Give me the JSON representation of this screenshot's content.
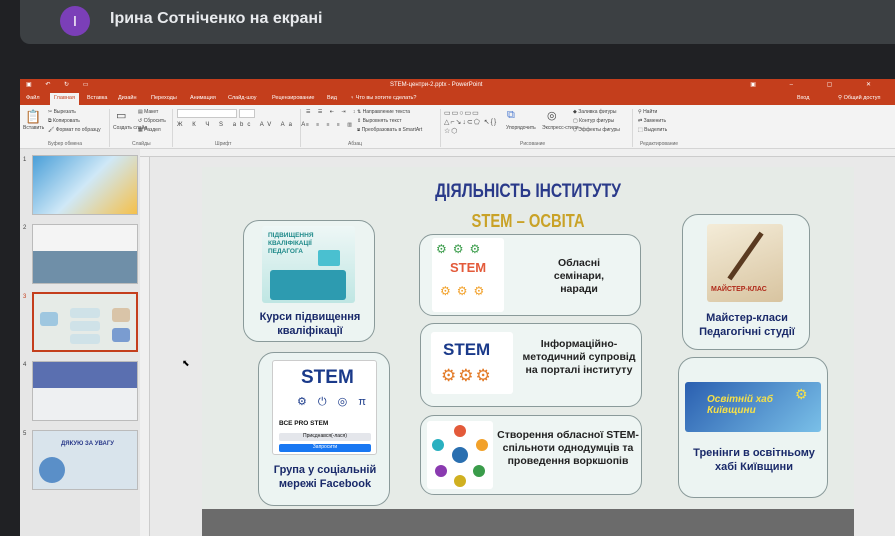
{
  "meet": {
    "avatar_letter": "I",
    "presenter_label": "Ірина Сотніченко на екрані"
  },
  "powerpoint": {
    "window_title": "STEM-центри-2.pptx - PowerPoint",
    "tabs": [
      "Файл",
      "Главная",
      "Вставка",
      "Дизайн",
      "Переходы",
      "Анимация",
      "Слайд-шоу",
      "Рецензирование",
      "Вид"
    ],
    "tell_me": "Что вы хотите сделать?",
    "signin": "Вход",
    "share": "Общий доступ",
    "ribbon": {
      "paste": "Вставить",
      "cut": "Вырезать",
      "copy": "Копировать",
      "format_painter": "Формат по образцу",
      "new_slide": "Создать слайд",
      "layout": "Макет",
      "reset": "Сбросить",
      "section": "Раздел",
      "text_direction": "Направление текста",
      "align_text": "Выровнять текст",
      "smartart": "Преобразовать в SmartArt",
      "arrange": "Упорядочить",
      "quick_styles": "Экспресс-стили",
      "shape_fill": "Заливка фигуры",
      "shape_outline": "Контур фигуры",
      "shape_effects": "Эффекты фигуры",
      "find": "Найти",
      "replace": "Заменить",
      "select": "Выделить",
      "groups": [
        "Буфер обмена",
        "Слайды",
        "Шрифт",
        "Абзац",
        "Рисование",
        "Редактирование"
      ]
    },
    "slide_numbers": [
      "1",
      "2",
      "3",
      "4",
      "5"
    ],
    "thumb5_text": "ДЯКУЮ ЗА УВАГУ"
  },
  "slide": {
    "title": "ДІЯЛЬНІСТЬ ІНСТИТУТУ",
    "subtitle": "STEM – ОСВІТА",
    "cards": {
      "courses": "Курси підвищення кваліфікації",
      "courses_img_text": "ПІДВИЩЕННЯ КВАЛІФІКАЦІЇ ПЕДАГОГА",
      "facebook": "Група у соціальній мережі Facebook",
      "fb_logo": "STEM",
      "fb_page": "ВСЕ PRO STEM",
      "fb_btn1": "Приєднався(-лася)",
      "fb_btn2": "Запросити",
      "seminars": "Обласні семінари, наради",
      "seminars_logo": "STEM",
      "info": "Інформаційно-методичний супровід на порталі інституту",
      "info_logo": "STEM",
      "community": "Створення обласної STEM-спільноти однодумців та проведення воркшопів",
      "master": "Майстер-класи Педагогічні студії",
      "master_img_text": "МАЙСТЕР-КЛАС",
      "trainings": "Тренінги в освітньому хабі Київщини",
      "hub_img_text": "Освітній хаб Київщини"
    }
  },
  "colors": {
    "ppt_accent": "#c43e1c",
    "title_blue": "#2a3a8a",
    "subtitle_gold": "#c9a227"
  }
}
